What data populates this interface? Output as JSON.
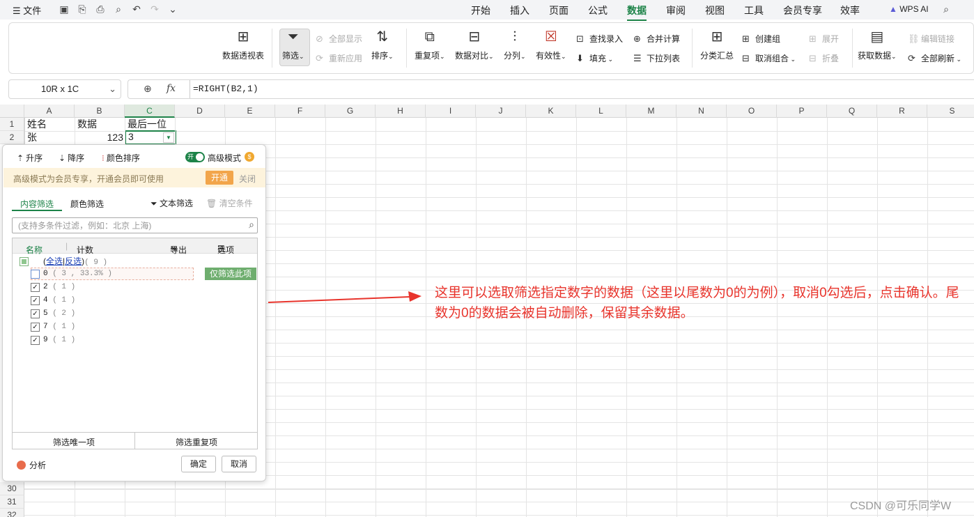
{
  "topbar": {
    "file_menu": "文件",
    "tabs": [
      "开始",
      "插入",
      "页面",
      "公式",
      "数据",
      "审阅",
      "视图",
      "工具",
      "会员专享",
      "效率"
    ],
    "active_tab": "数据",
    "wps_ai": "WPS AI"
  },
  "ribbon": {
    "pivot": "数据透视表",
    "filter": "筛选",
    "show_all": "全部显示",
    "reapply": "重新应用",
    "sort": "排序",
    "duplicates": "重复项",
    "compare": "数据对比",
    "split": "分列",
    "validity": "有效性",
    "lookup_entry": "查找录入",
    "fill": "填充",
    "consolidate": "合并计算",
    "dropdown_list": "下拉列表",
    "subtotal": "分类汇总",
    "create_group": "创建组",
    "ungroup": "取消组合",
    "expand": "展开",
    "collapse": "折叠",
    "get_data": "获取数据",
    "edit_links": "编辑链接",
    "refresh_all": "全部刷新"
  },
  "formula_bar": {
    "name_box": "10R x 1C",
    "formula": "=RIGHT(B2,1)"
  },
  "sheet": {
    "columns": [
      "A",
      "B",
      "C",
      "D",
      "E",
      "F",
      "G",
      "H",
      "I",
      "J",
      "K",
      "L",
      "M",
      "N",
      "O",
      "P",
      "Q",
      "R",
      "S"
    ],
    "selected_column": "C",
    "rows_top": [
      "1",
      "2"
    ],
    "rows_bottom": [
      "30",
      "31",
      "32"
    ],
    "cells": {
      "A1": "姓名",
      "B1": "数据",
      "C1": "最后一位",
      "A2": "张",
      "B2": "123",
      "C2": "3"
    }
  },
  "filter_panel": {
    "sort_asc": "升序",
    "sort_desc": "降序",
    "color_sort": "颜色排序",
    "toggle_on": "开",
    "advanced_mode": "高级模式",
    "banner_text": "高级模式为会员专享，开通会员即可使用",
    "banner_open": "开通",
    "banner_close": "关闭",
    "tab_content": "内容筛选",
    "tab_color": "颜色筛选",
    "text_filter": "文本筛选",
    "clear_condition": "清空条件",
    "search_placeholder": "(支持多条件过滤，例如：北京 上海)",
    "col_name": "名称",
    "col_count": "计数",
    "export": "导出",
    "options": "选项",
    "select_all": "全选",
    "invert": "反选",
    "all_count": "( 9 )",
    "items": [
      {
        "label": "0",
        "count": "( 3 , 33.3% )",
        "checked": false
      },
      {
        "label": "2",
        "count": "( 1 )",
        "checked": true
      },
      {
        "label": "4",
        "count": "( 1 )",
        "checked": true
      },
      {
        "label": "5",
        "count": "( 2 )",
        "checked": true
      },
      {
        "label": "7",
        "count": "( 1 )",
        "checked": true
      },
      {
        "label": "9",
        "count": "( 1 )",
        "checked": true
      }
    ],
    "only_this": "仅筛选此项",
    "filter_unique": "筛选唯一项",
    "filter_duplicate": "筛选重复项",
    "analysis": "分析",
    "ok": "确定",
    "cancel": "取消"
  },
  "annotation": "这里可以选取筛选指定数字的数据（这里以尾数为0的为例），取消0勾选后，点击确认。尾数为0的数据会被自动删除，保留其余数据。",
  "watermark": "CSDN @可乐同学W",
  "colors": {
    "accent": "#1d8348",
    "annotation": "#e8342c",
    "banner_button": "#f2a54a"
  }
}
